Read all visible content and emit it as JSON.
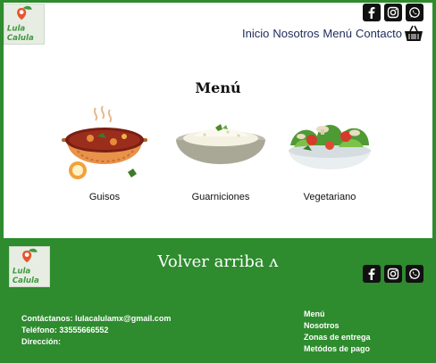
{
  "brand": {
    "logo_text": "Lula Calula"
  },
  "header": {
    "nav": [
      "Inicio",
      "Nosotros",
      "Menú",
      "Contacto"
    ],
    "social_icons": [
      "facebook-icon",
      "instagram-icon",
      "whatsapp-icon"
    ],
    "cart_icon": "cart-icon"
  },
  "main": {
    "title": "Menú",
    "categories": [
      {
        "label": "Guisos",
        "image": "stew-pot"
      },
      {
        "label": "Guarniciones",
        "image": "rice-bowl"
      },
      {
        "label": "Vegetariano",
        "image": "salad-bowl"
      }
    ]
  },
  "footer": {
    "back_to_top": "Volver arriba ʌ",
    "contact": {
      "email_line": "Contáctanos: lulacalulamx@gmail.com",
      "phone_line": "Teléfono: 33555666552",
      "address_line": "Dirección:"
    },
    "links": [
      "Menú",
      "Nosotros",
      "Zonas de entrega",
      "Metódos de pago"
    ]
  },
  "colors": {
    "brand_green": "#2e8b2e",
    "nav_text": "#1e2a5a"
  }
}
